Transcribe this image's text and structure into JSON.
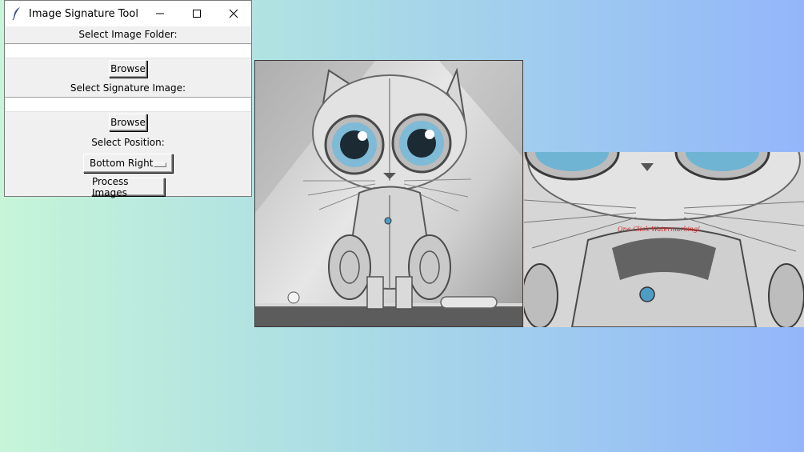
{
  "window": {
    "title": "Image Signature Tool"
  },
  "form": {
    "folder_label": "Select Image Folder:",
    "folder_value": "",
    "browse1_label": "Browse",
    "signature_label": "Select Signature Image:",
    "signature_value": "",
    "browse2_label": "Browse",
    "position_label": "Select Position:",
    "position_selected": "Bottom Right",
    "process_label": "Process Images"
  },
  "preview": {
    "watermark_text": "One Click Watermarking!"
  },
  "icons": {
    "app": "feather-icon",
    "minimize": "minimize-icon",
    "maximize": "maximize-icon",
    "close": "close-icon"
  },
  "colors": {
    "window_bg": "#f0f0f0",
    "desktop_left": "#c6f5d8",
    "desktop_right": "#93b6fb",
    "watermark": "#d22b2b"
  }
}
